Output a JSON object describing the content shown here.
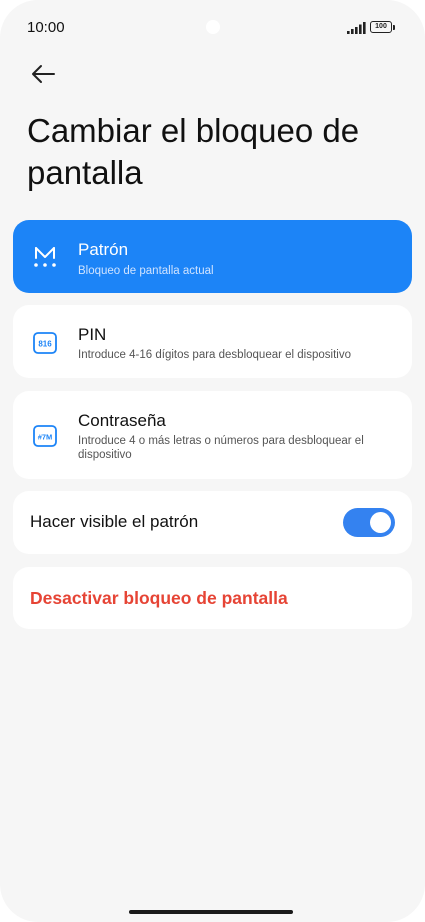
{
  "status_bar": {
    "time": "10:00",
    "battery": "100",
    "icons": [
      "signal-icon",
      "battery-icon"
    ]
  },
  "header": {
    "back_icon": "arrow-left-icon",
    "title": "Cambiar el bloqueo de pantalla"
  },
  "options": [
    {
      "title": "Patrón",
      "subtitle": "Bloqueo de pantalla actual",
      "icon": "pattern-icon",
      "selected": true
    },
    {
      "title": "PIN",
      "subtitle": "Introduce 4-16 dígitos para desbloquear el dispositivo",
      "icon": "pin-icon",
      "icon_text": "816",
      "selected": false
    },
    {
      "title": "Contraseña",
      "subtitle": "Introduce 4 o más letras o números para desbloquear el dispositivo",
      "icon": "password-icon",
      "icon_text": "#7M",
      "selected": false
    }
  ],
  "visible_pattern": {
    "label": "Hacer visible el patrón",
    "enabled": true
  },
  "disable_lock": {
    "label": "Desactivar bloqueo de pantalla",
    "color": "#e64435"
  },
  "colors": {
    "accent": "#1c84f7",
    "toggle": "#3482f0",
    "background": "#f6f6f6"
  }
}
